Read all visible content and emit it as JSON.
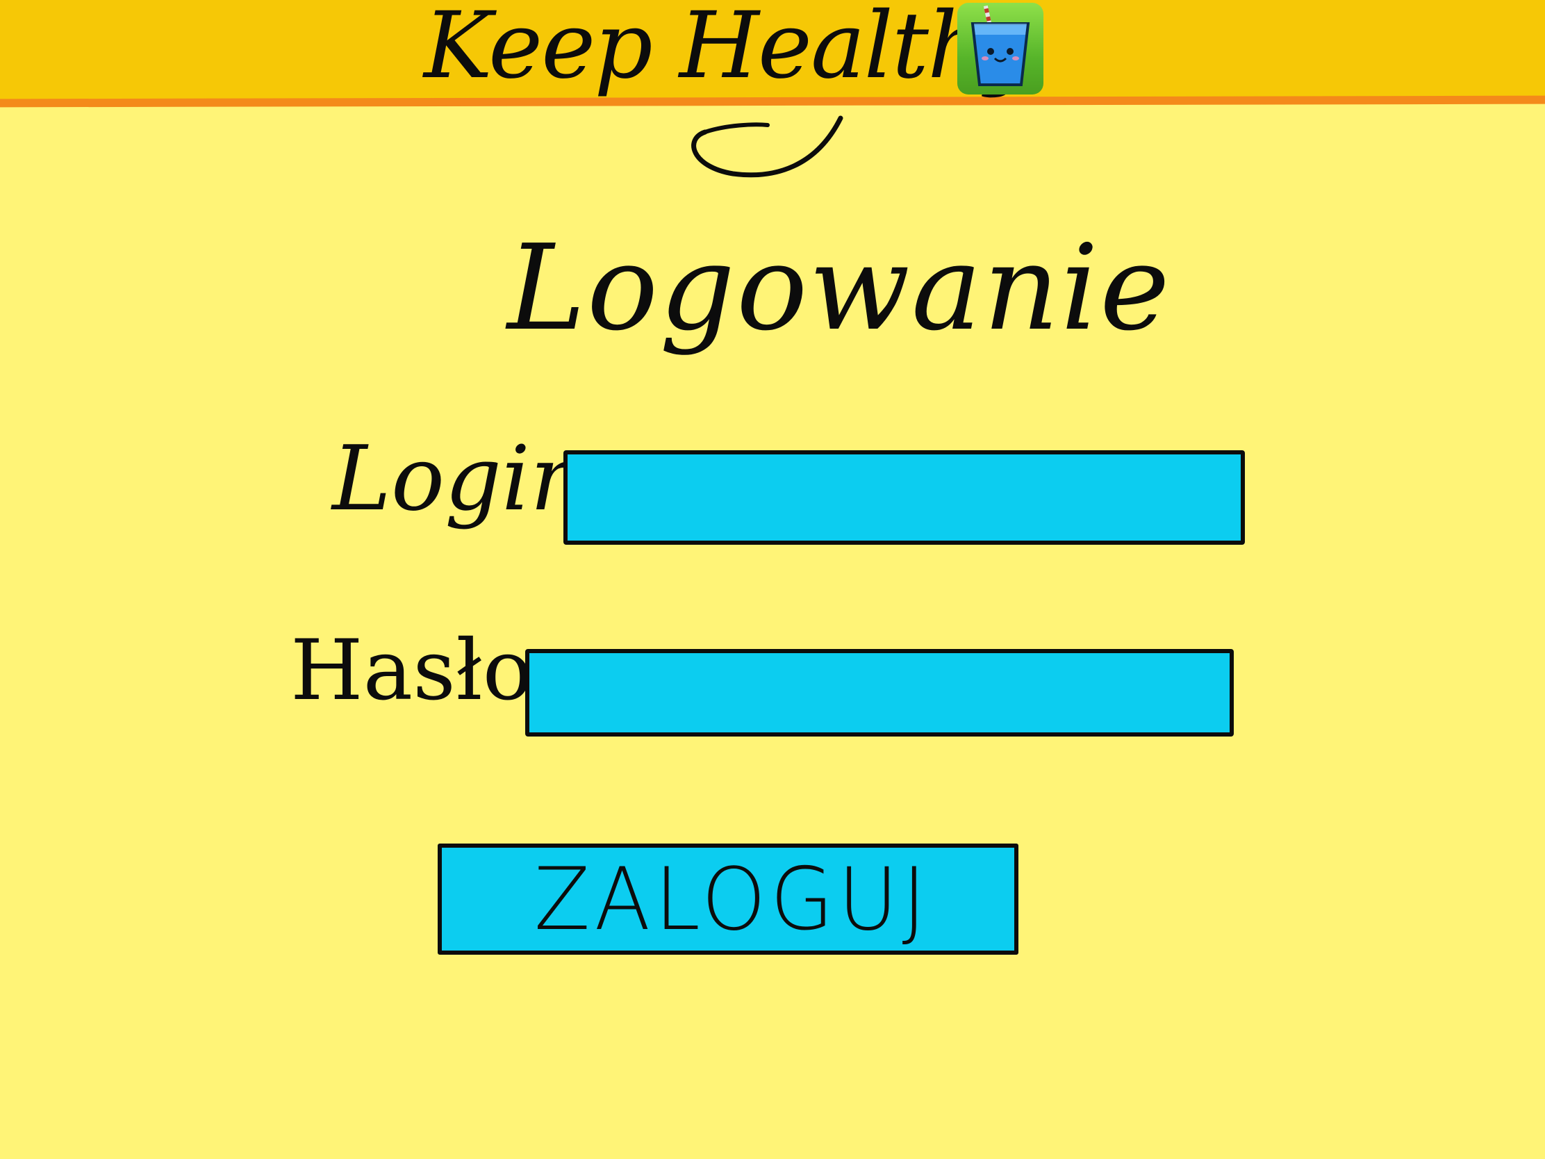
{
  "header": {
    "title": "Keep Healthy",
    "logo_icon": "water-glass-icon",
    "background": "#F6C806",
    "accent_line": "#F48A1A"
  },
  "login_form": {
    "heading": "Logowanie",
    "login_label": "Login",
    "login_value": "",
    "password_label": "Hasło",
    "password_value": "",
    "submit_label": "ZALOGUJ",
    "field_color": "#0CCDF0"
  },
  "page": {
    "background": "#FFF477"
  }
}
